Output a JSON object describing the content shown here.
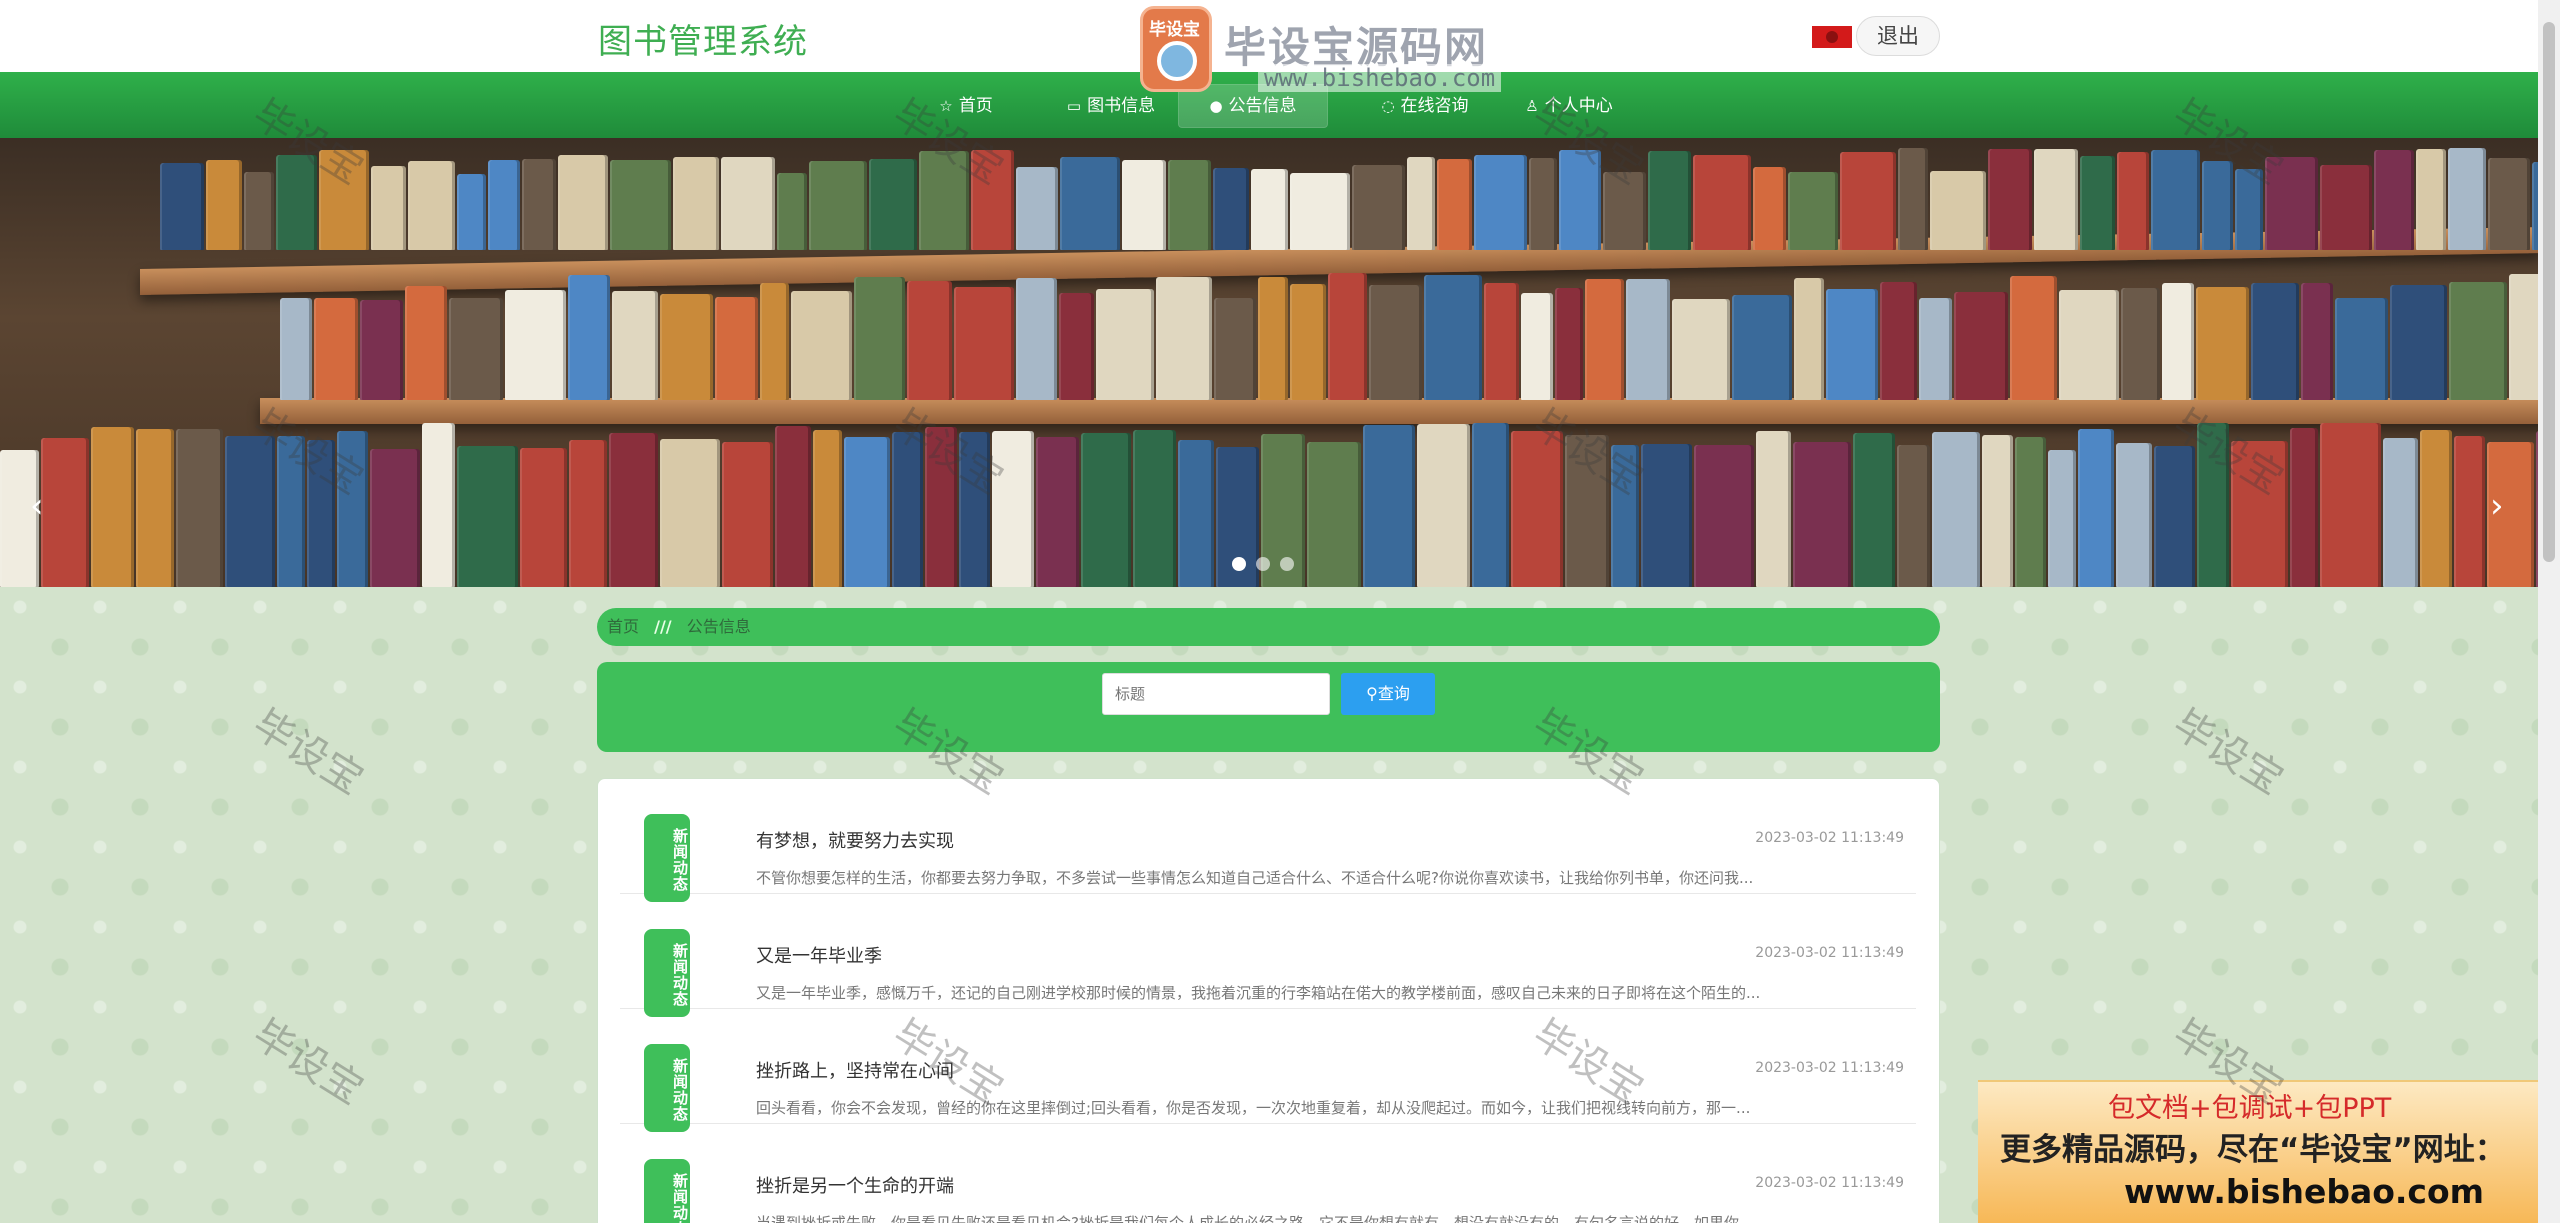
{
  "header": {
    "site_title": "图书管理系统",
    "logout_label": "退出"
  },
  "watermark_logo": {
    "badge_text": "毕设宝",
    "name": "毕设宝源码网",
    "url": "www.bishebao.com"
  },
  "nav": {
    "items": [
      {
        "icon": "home-icon",
        "label": "首页"
      },
      {
        "icon": "book-icon",
        "label": "图书信息"
      },
      {
        "icon": "info-icon",
        "label": "公告信息",
        "active": true
      },
      {
        "icon": "headset-icon",
        "label": "在线咨询"
      },
      {
        "icon": "user-icon",
        "label": "个人中心"
      }
    ]
  },
  "banner": {
    "prev": "‹",
    "next": "›",
    "slide_count": 3,
    "active_slide": 1
  },
  "breadcrumb": {
    "home": "首页",
    "separator": "///",
    "current": "公告信息"
  },
  "search": {
    "placeholder": "标题",
    "button_label": "查询"
  },
  "news": [
    {
      "badge": "新闻动态",
      "title": "有梦想，就要努力去实现",
      "time": "2023-03-02 11:13:49",
      "desc": "不管你想要怎样的生活，你都要去努力争取，不多尝试一些事情怎么知道自己适合什么、不适合什么呢?你说你喜欢读书，让我给你列书单，你还问我..."
    },
    {
      "badge": "新闻动态",
      "title": "又是一年毕业季",
      "time": "2023-03-02 11:13:49",
      "desc": "又是一年毕业季，感慨万千，还记的自己刚进学校那时候的情景，我拖着沉重的行李箱站在偌大的教学楼前面，感叹自己未来的日子即将在这个陌生的..."
    },
    {
      "badge": "新闻动态",
      "title": "挫折路上，坚持常在心间",
      "time": "2023-03-02 11:13:49",
      "desc": "回头看看，你会不会发现，曾经的你在这里摔倒过;回头看看，你是否发现，一次次地重复着，却从没爬起过。而如今，让我们把视线转向前方，那一..."
    },
    {
      "badge": "新闻动态",
      "title": "挫折是另一个生命的开端",
      "time": "2023-03-02 11:13:49",
      "desc": "当遇到挫折或失败，你是看见失败还是看见机会?挫折是我们每个人成长的必经之路，它不是你想有就有，想没有就没有的。有句名言说的好，如果你..."
    }
  ],
  "ad": {
    "line1": "包文档+包调试+包PPT",
    "line2": "更多精品源码，尽在“毕设宝”网址：",
    "line3": "www.bishebao.com"
  },
  "watermark_text": "毕设宝",
  "colors": {
    "accent_green": "#3fbf5a",
    "nav_green": "#22953d",
    "button_blue": "#2c9ff0",
    "title_green": "#3fae52"
  }
}
